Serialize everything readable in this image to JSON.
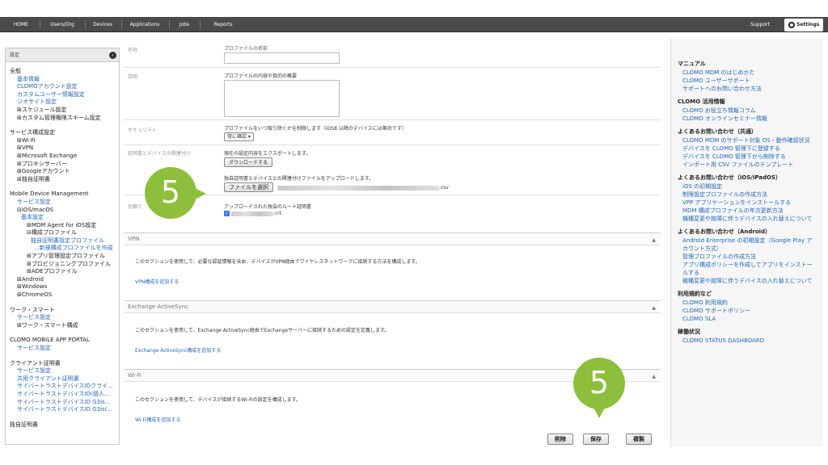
{
  "topnav": {
    "items": [
      "HOME",
      "Users/Org",
      "Devices",
      "Applications",
      "Jobs",
      "Reports"
    ],
    "support": "Support",
    "settings": "Settings"
  },
  "sidebar": {
    "header": "設定",
    "rows": [
      {
        "t": "全般",
        "c": "section",
        "i": ""
      },
      {
        "t": "基本情報",
        "c": "lnk",
        "i": "i1"
      },
      {
        "t": "CLOMOアカウント設定",
        "c": "lnk",
        "i": "i1"
      },
      {
        "t": "カスタムユーザー情報設定",
        "c": "lnk",
        "i": "i1"
      },
      {
        "t": "ジオサイト設定",
        "c": "lnk",
        "i": "i1"
      },
      {
        "t": "⊞スケジュール設定",
        "c": "dk",
        "i": "i1"
      },
      {
        "t": "⊞カスタム管理権限スキーム設定",
        "c": "dk",
        "i": "i1"
      },
      {
        "t": "",
        "c": "gap",
        "i": ""
      },
      {
        "t": "サービス構成設定",
        "c": "section",
        "i": ""
      },
      {
        "t": "⊞Wi-Fi",
        "c": "dk",
        "i": "i1"
      },
      {
        "t": "⊞VPN",
        "c": "dk",
        "i": "i1"
      },
      {
        "t": "⊞Microsoft Exchange",
        "c": "dk",
        "i": "i1"
      },
      {
        "t": "⊞プロキシサーバー",
        "c": "dk",
        "i": "i1"
      },
      {
        "t": "⊞Googleアカウント",
        "c": "dk",
        "i": "i1"
      },
      {
        "t": "⊞独自証明書",
        "c": "dk",
        "i": "i1"
      },
      {
        "t": "",
        "c": "gap",
        "i": ""
      },
      {
        "t": "Mobile Device Management",
        "c": "section",
        "i": ""
      },
      {
        "t": "サービス設定",
        "c": "lnk",
        "i": "i1"
      },
      {
        "t": "⊟iOS/macOS",
        "c": "dk",
        "i": "i1"
      },
      {
        "t": "基本設定",
        "c": "lnk",
        "i": "i2"
      },
      {
        "t": "⊞MDM Agent for iOS設定",
        "c": "dk",
        "i": "i3"
      },
      {
        "t": "⊟構成プロファイル",
        "c": "dk",
        "i": "i3"
      },
      {
        "t": "独自証明書設定プロファイル",
        "c": "lnk",
        "i": "i4"
      },
      {
        "t": "...新規構成プロファイルを作成",
        "c": "lnk",
        "i": "i5"
      },
      {
        "t": "⊞アプリ管理設定プロファイル",
        "c": "dk",
        "i": "i3"
      },
      {
        "t": "⊞プロビジョニングプロファイル",
        "c": "dk",
        "i": "i3"
      },
      {
        "t": "⊞ADEプロファイル",
        "c": "dk",
        "i": "i3"
      },
      {
        "t": "⊞Android",
        "c": "dk",
        "i": "i1"
      },
      {
        "t": "⊞Windows",
        "c": "dk",
        "i": "i1"
      },
      {
        "t": "⊞ChromeOS",
        "c": "dk",
        "i": "i1"
      },
      {
        "t": "",
        "c": "gap",
        "i": ""
      },
      {
        "t": "ワーク・スマート",
        "c": "section",
        "i": ""
      },
      {
        "t": "サービス設定",
        "c": "lnk",
        "i": "i1"
      },
      {
        "t": "⊞ワーク・スマート構成",
        "c": "dk",
        "i": "i1"
      },
      {
        "t": "",
        "c": "gap",
        "i": ""
      },
      {
        "t": "CLOMO MOBILE APP PORTAL",
        "c": "section",
        "i": ""
      },
      {
        "t": "サービス設定",
        "c": "lnk",
        "i": "i1"
      },
      {
        "t": "",
        "c": "gap",
        "i": ""
      },
      {
        "t": "クライアント証明書",
        "c": "section",
        "i": ""
      },
      {
        "t": "サービス設定",
        "c": "lnk",
        "i": "i1"
      },
      {
        "t": "共用クライアント証明書",
        "c": "lnk",
        "i": "i1"
      },
      {
        "t": "サイバートラストデバイスIDクライ...",
        "c": "lnk",
        "i": "i1"
      },
      {
        "t": "サイバートラストデバイスID(個人...",
        "c": "lnk",
        "i": "i1"
      },
      {
        "t": "サイバートラストデバイスID G3is...",
        "c": "lnk",
        "i": "i1"
      },
      {
        "t": "サイバートラストデバイスID G3is(...",
        "c": "lnk",
        "i": "i1"
      },
      {
        "t": "",
        "c": "gap",
        "i": ""
      },
      {
        "t": "独自証明書",
        "c": "section",
        "i": ""
      }
    ]
  },
  "form": {
    "name_label": "名称",
    "name_hint": "プロファイルの名前",
    "desc_label": "説明",
    "desc_hint": "プロファイルの内容や目的の概要",
    "security_label": "セキュリティ",
    "security_hint": "プロファイルをいつ取り除くかを制限します（iOS8 以降のデバイスには無効です）",
    "security_value": "常に確認 ▾",
    "assoc_label": "証明書とデバイスの関連付け",
    "export_hint": "現在の設定内容をエクスポートします。",
    "download_button": "ダウンロードする",
    "upload_hint": "独自証明書とデバイスとの関連付けファイルをアップロードします。",
    "choose_file_button": "ファイルを選択",
    "file_ext": ".csv",
    "trust_label": "信頼で",
    "trust_hint": "アップロードされた独自のルート証明書",
    "cert_ext": ".crt"
  },
  "panels": {
    "vpn": {
      "title": "VPN",
      "desc": "このセクションを使用して、必要な認証情報を含め、デバイスがVPN経由でワイヤレスネットワークに接続する方法を構成します。",
      "link": "VPN構成を追加する"
    },
    "exchange": {
      "title": "Exchange ActiveSync",
      "desc": "このセクションを使用して、Exchange ActiveSync経由でExchangeサーバーに接続するための設定を定義します。",
      "link": "Exchange ActiveSync構成を追加する"
    },
    "wifi": {
      "title": "Wi-Fi",
      "desc": "このセクションを使用して、デバイスが接続するWi-Fiの設定を構成します。",
      "link": "Wi-Fi構成を追加する"
    }
  },
  "actions": {
    "delete": "削除",
    "save": "保存",
    "copy": "複製"
  },
  "callouts": {
    "upload_step": "5",
    "save_step": "5"
  },
  "help": {
    "groups": [
      {
        "h": "マニュアル",
        "links": [
          "CLOMO MDM のはじめかた",
          "CLOMO ユーザーサポート",
          "サポートへのお問い合わせ方法"
        ]
      },
      {
        "h": "CLOMO 活用情報",
        "links": [
          "CLOMO お役立ち情報コラム",
          "CLOMO オンラインセミナー情報"
        ]
      },
      {
        "h": "よくあるお問い合わせ（共通）",
        "links": [
          "CLOMO MDM のサポート対象 OS・動作確認状況",
          "デバイスを CLOMO 管理下に登録する",
          "デバイスを CLOMO 管理下から削除する",
          "インポート用 CSV ファイルのテンプレート"
        ]
      },
      {
        "h": "よくあるお問い合わせ（iOS/iPadOS）",
        "links": [
          "iOS の初期設定",
          "制限設定プロファイルの作成方法",
          "VPP アプリケーションをインストールする",
          "MDM 構成プロファイルの年次更新方法",
          "機種変更や故障に伴うデバイスの入れ替えについて"
        ]
      },
      {
        "h": "よくあるお問い合わせ（Android）",
        "links": [
          "Android Enterprise の初期設定（Google Play アカウント方式）",
          "管理プロファイルの作成方法",
          "アプリ構成ポリシーを作成してアプリをインストールする",
          "機種変更や故障に伴うデバイスの入れ替えについて"
        ]
      },
      {
        "h": "利用規約など",
        "links": [
          "CLOMO 利用規約",
          "CLOMO サポートポリシー",
          "CLOMO SLA"
        ]
      },
      {
        "h": "稼働状況",
        "links": [
          "CLOMO STATUS DASHBOARD"
        ]
      }
    ]
  },
  "colors": {
    "accent_link": "#2468b8",
    "callout": "#8dbf3c",
    "nav_bg": "#4a4a4a"
  }
}
